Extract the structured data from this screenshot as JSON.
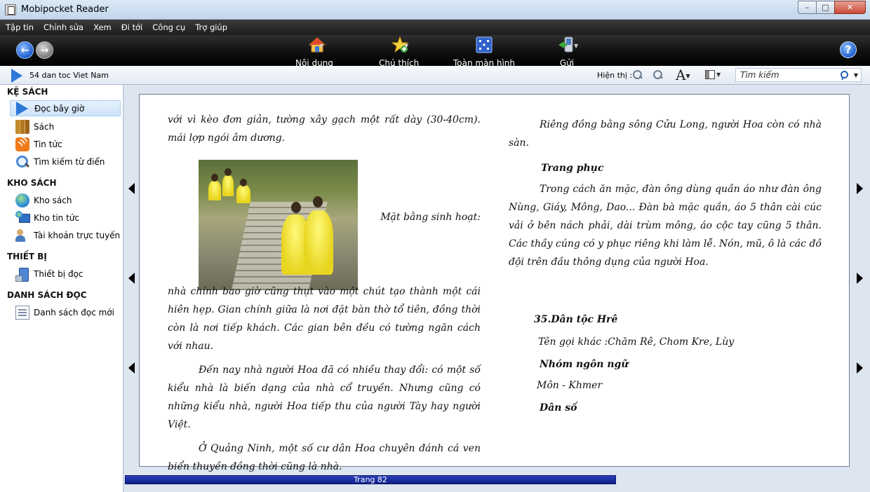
{
  "window": {
    "title": "Mobipocket Reader"
  },
  "menu": [
    "Tập tin",
    "Chỉnh sửa",
    "Xem",
    "Đi tới",
    "Công cụ",
    "Trợ giúp"
  ],
  "toolbar": {
    "tools": [
      {
        "label": "Nội dung",
        "icon": "home-icon"
      },
      {
        "label": "Chú thích",
        "icon": "star-icon"
      },
      {
        "label": "Toàn màn hình",
        "icon": "fullscreen-icon"
      },
      {
        "label": "Gửi",
        "icon": "send-icon"
      }
    ],
    "help_label": "?"
  },
  "address": {
    "book_title": "54 dan toc Viet Nam",
    "view_label": "Hiện thị :",
    "search_placeholder": "Tìm kiếm"
  },
  "sidebar": {
    "sections": [
      {
        "title": "KỆ SÁCH",
        "items": [
          {
            "label": "Đọc bây giờ",
            "icon": "play-icon",
            "selected": true
          },
          {
            "label": "Sách",
            "icon": "books-icon"
          },
          {
            "label": "Tin tức",
            "icon": "rss-icon"
          },
          {
            "label": "Tìm kiếm từ điển",
            "icon": "dictionary-search-icon"
          }
        ]
      },
      {
        "title": "KHO SÁCH",
        "items": [
          {
            "label": "Kho sách",
            "icon": "globe-icon"
          },
          {
            "label": "Kho tin tức",
            "icon": "news-store-icon"
          },
          {
            "label": "Tài khoản trực tuyến",
            "icon": "users-icon"
          }
        ]
      },
      {
        "title": "THIẾT BỊ",
        "items": [
          {
            "label": "Thiết bị đọc",
            "icon": "device-icon"
          }
        ]
      },
      {
        "title": "DANH SÁCH ĐỌC",
        "items": [
          {
            "label": "Danh sách đọc mới",
            "icon": "reading-list-icon"
          }
        ]
      }
    ]
  },
  "page": {
    "left": {
      "p1": "với vì kèo đơn giản, tường xây gạch một rất dày (30-40cm). mái lợp ngói âm dương.",
      "caption_right": "Mặt bằng sinh hoạt:",
      "p2": "nhà chính bao giờ cũng thụt vào một chút tạo thành một cái hiên hẹp. Gian chính giữa là nơi đặt bàn thờ tổ tiên, đồng thời còn là nơi tiếp khách. Các gian bên đều có tường ngăn cách với nhau.",
      "p3": "Đến nay nhà người Hoa đã có nhiều thay đổi: có một số kiểu nhà là biến dạng của nhà cổ truyền. Nhưng cũng có những kiểu nhà, người Hoa tiếp thu của người Tày hay người Việt.",
      "p4": "Ở Quảng Ninh, một số cư dân Hoa chuyên đánh cá ven biển thuyền đồng thời cũng là nhà."
    },
    "right": {
      "p1": "Riêng đồng bằng sông Cửu Long, người Hoa còn có nhà sàn.",
      "h1": "Trang phục",
      "p2": "Trong cách ăn mặc, đàn ông dùng quần áo như đàn ông Nùng, Giáy, Mông, Dao... Đàn bà mặc quần, áo 5 thân cài cúc vải ở bên nách phải, dài trùm mông, áo cộc tay cũng 5 thân. Các thầy cúng có y phục riêng khi làm lễ. Nón, mũ, ô là các đồ đội trên đầu thông dụng của người Hoa.",
      "h2": "35.Dân tộc Hrê",
      "p3": "Tên gọi khác :Chăm Rê, Chom Kre, Lùy",
      "h3": "Nhóm ngôn ngữ",
      "p4": "Môn - Khmer",
      "h4": "Dân số"
    }
  },
  "status": {
    "page_label": "Trang 82",
    "progress_fraction": 0.66
  }
}
